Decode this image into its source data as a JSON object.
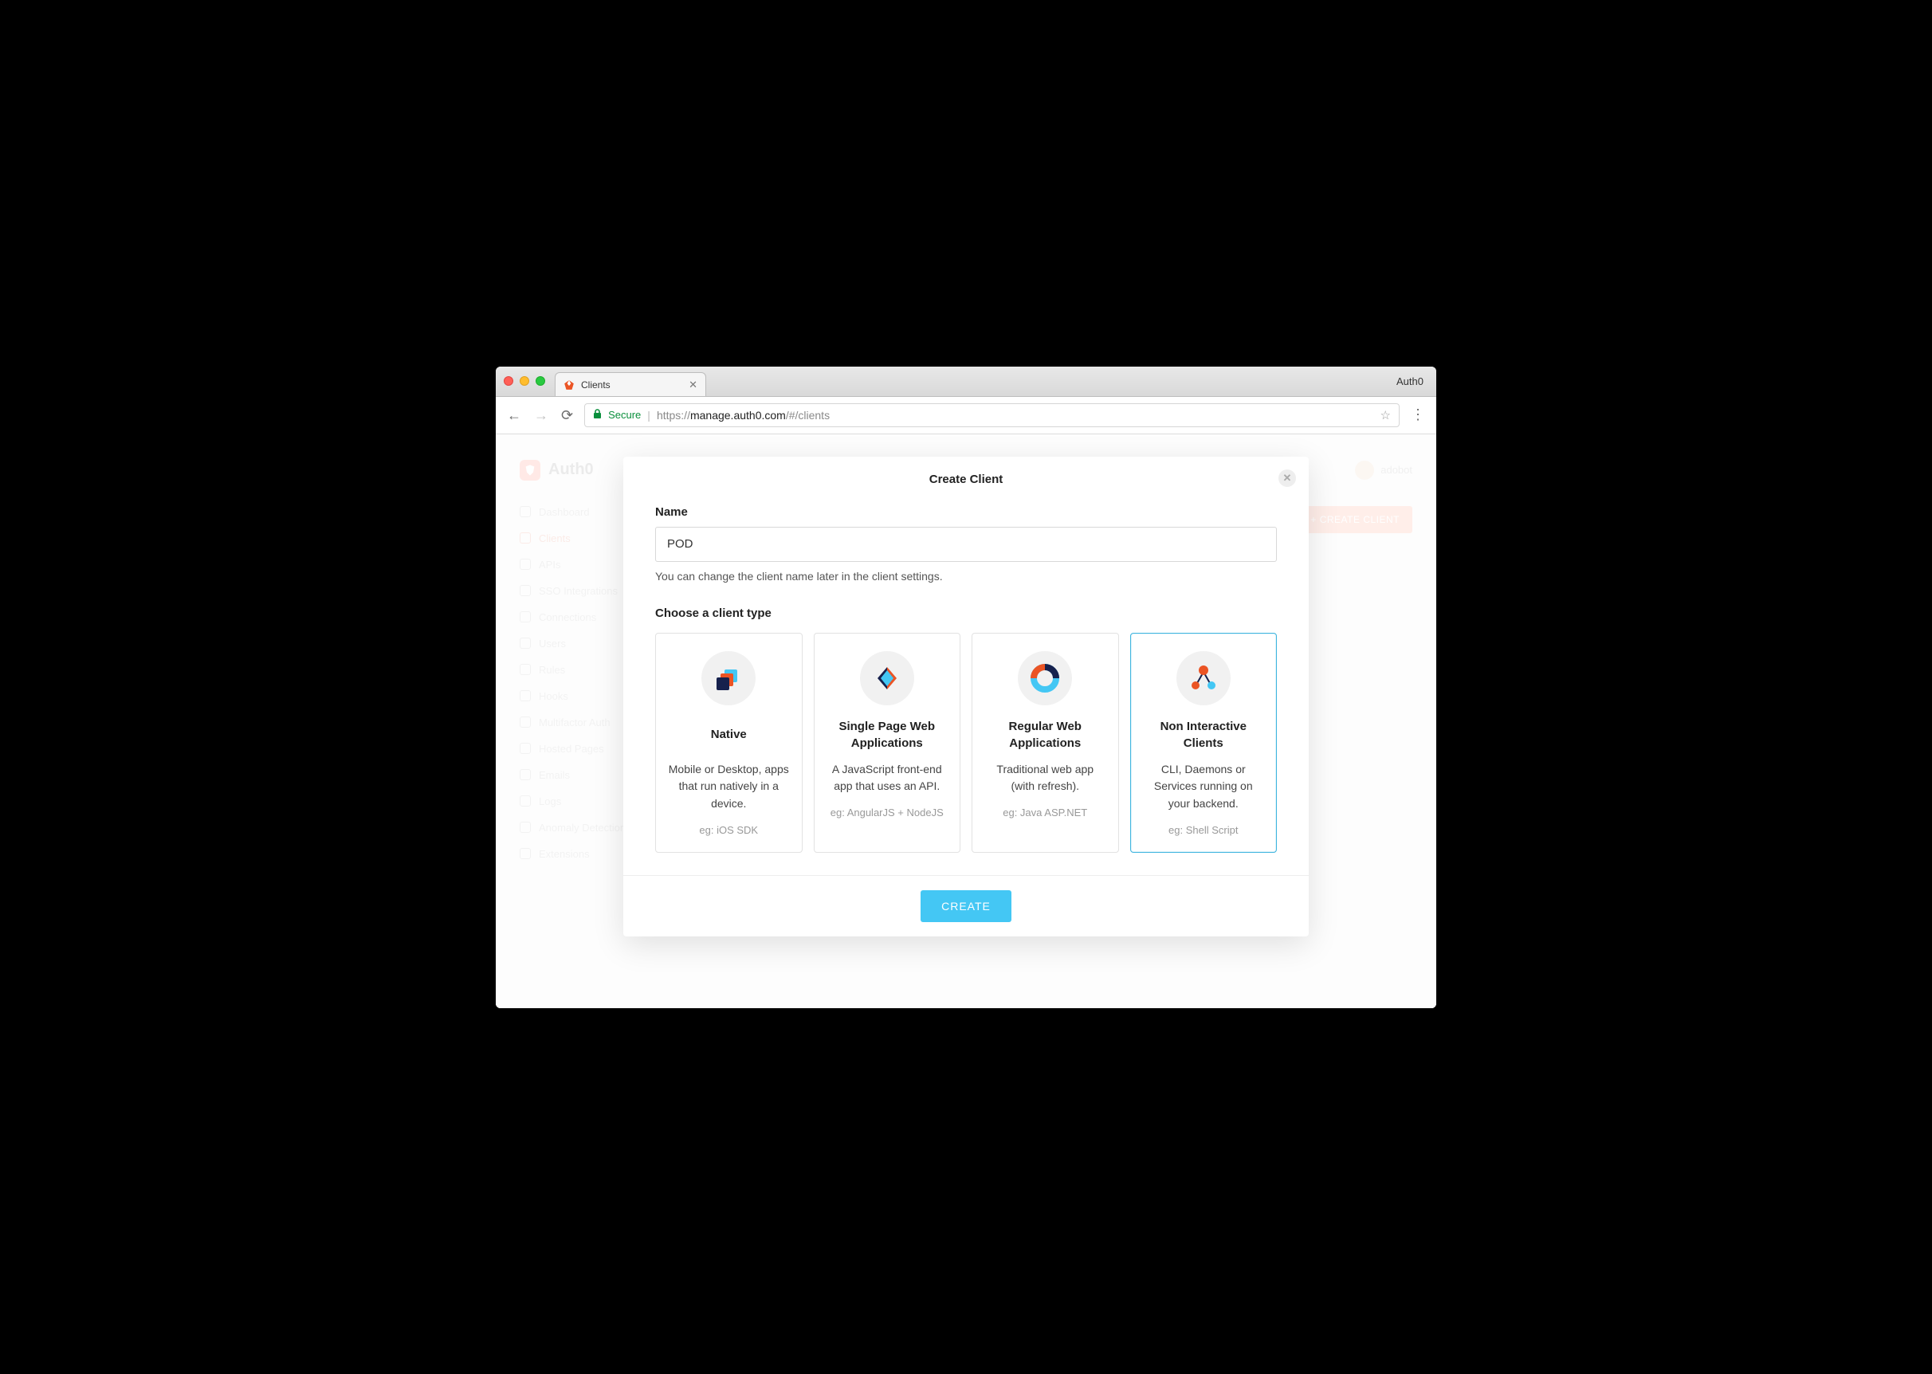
{
  "browser": {
    "tab_title": "Clients",
    "window_right_label": "Auth0",
    "secure_label": "Secure",
    "url_scheme": "https://",
    "url_host": "manage.auth0.com",
    "url_path": "/#/clients"
  },
  "background": {
    "brand": "Auth0",
    "user_name": "adobot",
    "cta_label": "+ CREATE CLIENT",
    "sidebar": {
      "items": [
        {
          "label": "Dashboard"
        },
        {
          "label": "Clients"
        },
        {
          "label": "APIs"
        },
        {
          "label": "SSO Integrations"
        },
        {
          "label": "Connections"
        },
        {
          "label": "Users"
        },
        {
          "label": "Rules"
        },
        {
          "label": "Hooks"
        },
        {
          "label": "Multifactor Auth"
        },
        {
          "label": "Hosted Pages"
        },
        {
          "label": "Emails"
        },
        {
          "label": "Logs"
        },
        {
          "label": "Anomaly Detection"
        },
        {
          "label": "Extensions"
        }
      ],
      "active_index": 1
    }
  },
  "modal": {
    "title": "Create Client",
    "name_label": "Name",
    "name_value": "POD",
    "name_help": "You can change the client name later in the client settings.",
    "type_label": "Choose a client type",
    "create_button": "CREATE",
    "cards": [
      {
        "title": "Native",
        "desc": "Mobile or Desktop, apps that run natively in a device.",
        "example": "eg: iOS SDK"
      },
      {
        "title": "Single Page Web Applications",
        "desc": "A JavaScript front-end app that uses an API.",
        "example": "eg: AngularJS + NodeJS"
      },
      {
        "title": "Regular Web Applications",
        "desc": "Traditional web app (with refresh).",
        "example": "eg: Java ASP.NET"
      },
      {
        "title": "Non Interactive Clients",
        "desc": "CLI, Daemons or Services running on your backend.",
        "example": "eg: Shell Script"
      }
    ],
    "selected_card_index": 3
  }
}
